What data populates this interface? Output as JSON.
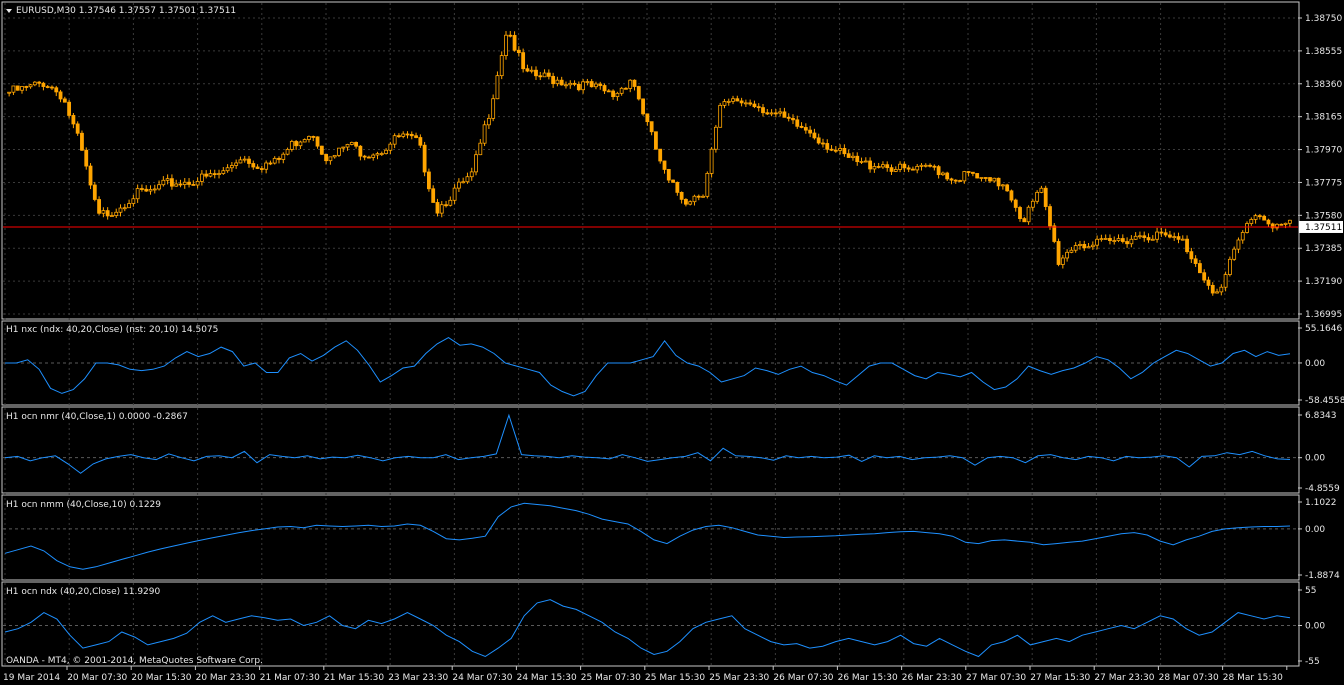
{
  "window": {
    "symbol_line": "EURUSD,M30  1.37546 1.37557 1.37501 1.37511",
    "copyright": "OANDA - MT4, © 2001-2014, MetaQuotes Software Corp."
  },
  "colors": {
    "background": "#000000",
    "candle": "#ffa500",
    "indicator": "#1e90ff",
    "price_line": "#ff0000",
    "grid": "#3a3a3a",
    "text": "#e8e8e8"
  },
  "chart_data": [
    {
      "type": "candlestick",
      "ylim": [
        1.36995,
        1.3875
      ],
      "y_ticks": [
        "1.38750",
        "1.38555",
        "1.38360",
        "1.38165",
        "1.37970",
        "1.37775",
        "1.37580",
        "1.37385",
        "1.37190",
        "1.36995"
      ],
      "current_price": 1.37511,
      "current_price_label": "1.37511",
      "closes": [
        1.3831,
        1.3833,
        1.3837,
        1.3829,
        1.3799,
        1.3757,
        1.3762,
        1.377,
        1.3772,
        1.3777,
        1.3778,
        1.378,
        1.3783,
        1.3793,
        1.3788,
        1.3789,
        1.3801,
        1.3808,
        1.379,
        1.38,
        1.3795,
        1.3797,
        1.3805,
        1.3801,
        1.3761,
        1.3772,
        1.3781,
        1.382,
        1.387,
        1.3841,
        1.384,
        1.3838,
        1.3836,
        1.3833,
        1.3829,
        1.384,
        1.3808,
        1.3778,
        1.3767,
        1.3772,
        1.3822,
        1.3826,
        1.3824,
        1.3818,
        1.3812,
        1.3808,
        1.38,
        1.3792,
        1.3788,
        1.3789,
        1.3785,
        1.3784,
        1.3787,
        1.378,
        1.3782,
        1.3777,
        1.3777,
        1.3755,
        1.3773,
        1.3731,
        1.3742,
        1.374,
        1.3742,
        1.3745,
        1.3747,
        1.3745,
        1.3742,
        1.3725,
        1.371,
        1.374,
        1.376,
        1.3753,
        1.3752
      ]
    },
    {
      "type": "line",
      "title": "H1  nxc (ndx: 40,20,Close) (nst: 20,10) 14.5075",
      "ylim": [
        -58.4558,
        55.1646
      ],
      "y_ticks": [
        "55.1646",
        "0.00",
        "-58.4558"
      ],
      "series": [
        {
          "values": [
            0,
            0,
            5,
            -10,
            -40,
            -48,
            -42,
            -25,
            0,
            0,
            -3,
            -10,
            -12,
            -10,
            -5,
            8,
            18,
            10,
            15,
            25,
            18,
            -5,
            0,
            -15,
            -15,
            8,
            15,
            3,
            12,
            25,
            35,
            20,
            -3,
            -30,
            -20,
            -8,
            -5,
            15,
            30,
            40,
            28,
            30,
            25,
            15,
            0,
            -5,
            -10,
            -15,
            -35,
            -45,
            -52,
            -45,
            -20,
            0,
            0,
            0,
            5,
            10,
            35,
            12,
            0,
            -5,
            -15,
            -30,
            -25,
            -20,
            -8,
            -12,
            -18,
            -10,
            -5,
            -15,
            -20,
            -28,
            -35,
            -20,
            -5,
            0,
            0,
            -10,
            -20,
            -25,
            -15,
            -18,
            -22,
            -15,
            -30,
            -42,
            -38,
            -25,
            -5,
            -12,
            -18,
            -12,
            -8,
            0,
            10,
            5,
            -8,
            -25,
            -15,
            0,
            10,
            20,
            15,
            5,
            -5,
            0,
            15,
            20,
            10,
            18,
            12,
            14.5
          ]
        }
      ]
    },
    {
      "type": "line",
      "title": "H1   ocn nmr (40,Close,1) 0.0000 -0.2867",
      "ylim": [
        -4.8559,
        6.8343
      ],
      "y_ticks": [
        "6.8343",
        "0.00",
        "-4.8559"
      ],
      "series": [
        {
          "values": [
            0,
            0.2,
            -0.5,
            0,
            0.3,
            -1,
            -2.5,
            -1,
            -0.2,
            0.2,
            0.5,
            0,
            -0.3,
            0.6,
            0,
            -0.5,
            0.2,
            0.3,
            0,
            1,
            -0.8,
            0.5,
            0.2,
            0,
            0.3,
            -0.2,
            0.1,
            0,
            0.4,
            0,
            -0.5,
            0,
            0.2,
            0,
            0,
            0.5,
            -0.3,
            0,
            0.2,
            0.6,
            6.8,
            0.5,
            0.3,
            0.2,
            0,
            0.3,
            0.1,
            0,
            -0.2,
            0.5,
            0,
            -0.6,
            -0.3,
            0,
            0.2,
            0.8,
            -0.5,
            1.5,
            0.3,
            0.2,
            0,
            -0.4,
            0.3,
            0,
            0.2,
            0,
            0.1,
            0.4,
            -0.6,
            0.3,
            0,
            0.2,
            -0.3,
            0,
            0.1,
            0.3,
            0,
            -1.2,
            0,
            0.2,
            0,
            -0.8,
            0.3,
            0.5,
            0,
            -0.3,
            0.2,
            0,
            -0.5,
            0.2,
            0,
            0.1,
            0.3,
            0,
            -1.5,
            0.2,
            0.3,
            0.8,
            0.5,
            1.0,
            0.3,
            -0.2,
            -0.286
          ]
        }
      ]
    },
    {
      "type": "line",
      "title": "H1   ocn nmm  (40,Close,10) 0.1229",
      "ylim": [
        -1.8874,
        1.1022
      ],
      "y_ticks": [
        "1.1022",
        "0.00",
        "-1.8874"
      ],
      "series": [
        {
          "values": [
            -1.0,
            -0.85,
            -0.7,
            -0.9,
            -1.3,
            -1.55,
            -1.65,
            -1.55,
            -1.4,
            -1.25,
            -1.1,
            -0.95,
            -0.82,
            -0.7,
            -0.58,
            -0.47,
            -0.36,
            -0.26,
            -0.16,
            -0.07,
            0.0,
            0.08,
            0.1,
            0.05,
            0.15,
            0.12,
            0.1,
            0.12,
            0.15,
            0.1,
            0.12,
            0.2,
            0.15,
            -0.1,
            -0.4,
            -0.45,
            -0.38,
            -0.3,
            0.5,
            0.9,
            1.05,
            1.0,
            0.95,
            0.85,
            0.75,
            0.6,
            0.4,
            0.3,
            0.2,
            -0.1,
            -0.45,
            -0.6,
            -0.3,
            -0.05,
            0.1,
            0.15,
            0.05,
            -0.1,
            -0.25,
            -0.3,
            -0.35,
            -0.33,
            -0.32,
            -0.3,
            -0.28,
            -0.25,
            -0.22,
            -0.2,
            -0.15,
            -0.12,
            -0.1,
            -0.15,
            -0.2,
            -0.3,
            -0.55,
            -0.6,
            -0.48,
            -0.45,
            -0.5,
            -0.55,
            -0.65,
            -0.6,
            -0.55,
            -0.5,
            -0.4,
            -0.3,
            -0.2,
            -0.15,
            -0.25,
            -0.5,
            -0.65,
            -0.45,
            -0.3,
            -0.1,
            0.0,
            0.05,
            0.08,
            0.1,
            0.1,
            0.12
          ]
        }
      ]
    },
    {
      "type": "line",
      "title": "H1   ocn ndx (40,20,Close) 11.9290",
      "ylim": [
        -55,
        55
      ],
      "y_ticks": [
        "55",
        "0.00",
        "-55"
      ],
      "series": [
        {
          "values": [
            -10,
            -5,
            5,
            20,
            10,
            -15,
            -35,
            -30,
            -25,
            -10,
            -18,
            -30,
            -25,
            -20,
            -12,
            5,
            15,
            5,
            10,
            15,
            12,
            8,
            10,
            0,
            5,
            15,
            0,
            -5,
            8,
            3,
            10,
            20,
            10,
            0,
            -15,
            -25,
            -40,
            -48,
            -35,
            -20,
            15,
            35,
            40,
            30,
            25,
            15,
            5,
            -10,
            -20,
            -35,
            -45,
            -40,
            -25,
            -5,
            5,
            10,
            15,
            -5,
            -15,
            -25,
            -30,
            -28,
            -35,
            -32,
            -25,
            -20,
            -25,
            -30,
            -25,
            -15,
            -28,
            -32,
            -20,
            -30,
            -40,
            -48,
            -30,
            -25,
            -15,
            -30,
            -25,
            -20,
            -25,
            -15,
            -10,
            -5,
            0,
            -5,
            5,
            15,
            10,
            -5,
            -15,
            -10,
            5,
            20,
            15,
            10,
            15,
            12
          ]
        }
      ]
    }
  ],
  "x_axis": {
    "labels": [
      "19 Mar 2014",
      "20 Mar 07:30",
      "20 Mar 15:30",
      "20 Mar 23:30",
      "21 Mar 07:30",
      "21 Mar 15:30",
      "23 Mar 23:30",
      "24 Mar 07:30",
      "24 Mar 15:30",
      "25 Mar 07:30",
      "25 Mar 15:30",
      "25 Mar 23:30",
      "26 Mar 07:30",
      "26 Mar 15:30",
      "26 Mar 23:30",
      "27 Mar 07:30",
      "27 Mar 15:30",
      "27 Mar 23:30",
      "28 Mar 07:30",
      "28 Mar 15:30"
    ]
  }
}
